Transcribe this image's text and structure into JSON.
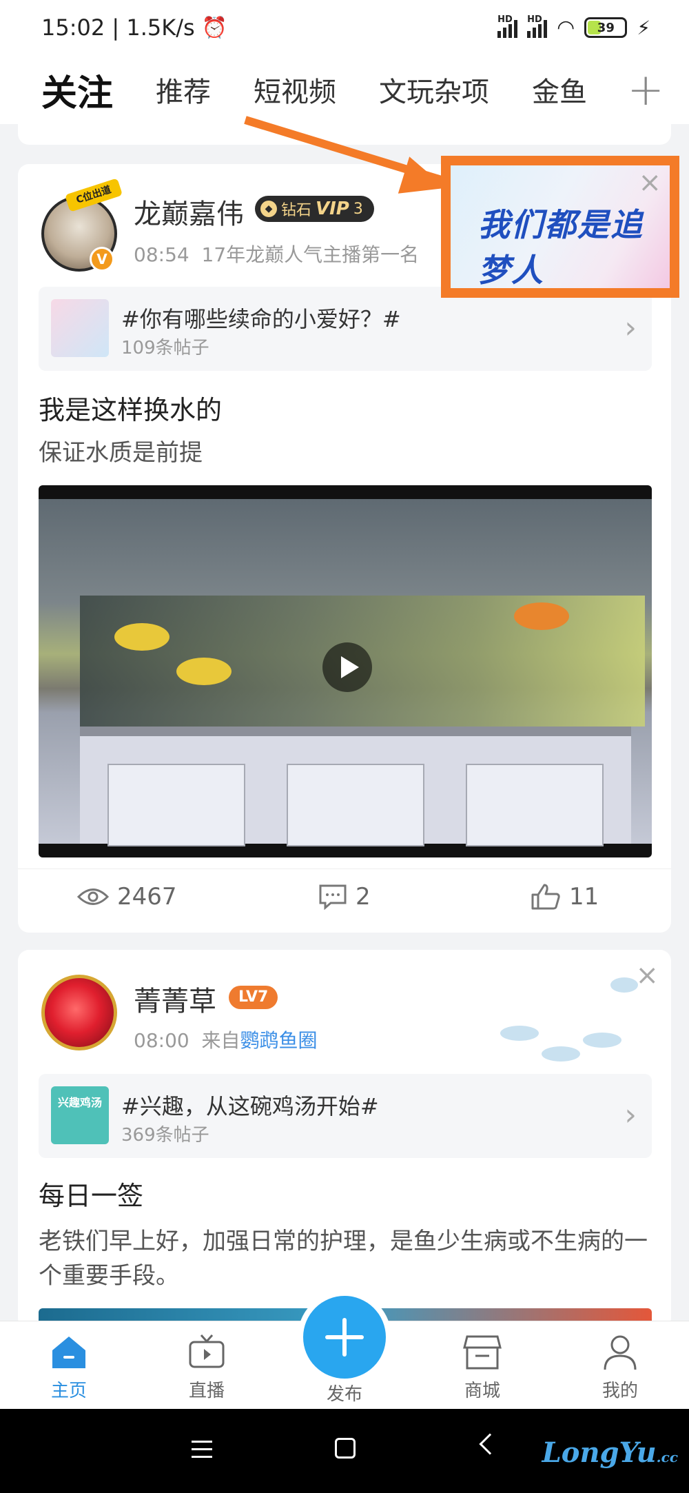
{
  "status_bar": {
    "time": "15:02",
    "speed": "1.5K/s",
    "battery": "39",
    "hd": "HD"
  },
  "tabs": [
    {
      "label": "关注",
      "active": true
    },
    {
      "label": "推荐",
      "active": false
    },
    {
      "label": "短视频",
      "active": false
    },
    {
      "label": "文玩杂项",
      "active": false
    },
    {
      "label": "金鱼",
      "active": false
    }
  ],
  "post1": {
    "avatar_badge": "C位出道",
    "username": "龙巅嘉伟",
    "vip_prefix": "钻石",
    "vip_label": "VIP",
    "vip_level": "3",
    "time": "08:54",
    "signature": "17年龙巅人气主播第一名",
    "topic_title": "#你有哪些续命的小爱好？#",
    "topic_count": "109条帖子",
    "title": "我是这样换水的",
    "body": "保证水质是前提",
    "views": "2467",
    "comments": "2",
    "likes": "11"
  },
  "ad": {
    "text": "我们都是追梦人"
  },
  "post2": {
    "username": "菁菁草",
    "level": "LV7",
    "time": "08:00",
    "source_prefix": "来自",
    "source": "鹦鹉鱼圈",
    "topic_title": "#兴趣，从这碗鸡汤开始#",
    "topic_thumb_label": "兴趣鸡汤",
    "topic_count": "369条帖子",
    "title": "每日一签",
    "body": "老铁们早上好，加强日常的护理，是鱼少生病或不生病的一个重要手段。"
  },
  "bottom_nav": [
    {
      "label": "主页",
      "icon": "home-icon",
      "active": true
    },
    {
      "label": "直播",
      "icon": "tv-icon",
      "active": false
    },
    {
      "label": "发布",
      "icon": "plus-icon",
      "active": false
    },
    {
      "label": "商城",
      "icon": "store-icon",
      "active": false
    },
    {
      "label": "我的",
      "icon": "user-icon",
      "active": false
    }
  ],
  "watermark": {
    "brand": "LongYu",
    "suffix": ".cc"
  },
  "colors": {
    "accent": "#29a6ef",
    "ad_border": "#f47b28",
    "vip_gold": "#f4d48a",
    "level_badge": "#ef7b2f"
  }
}
